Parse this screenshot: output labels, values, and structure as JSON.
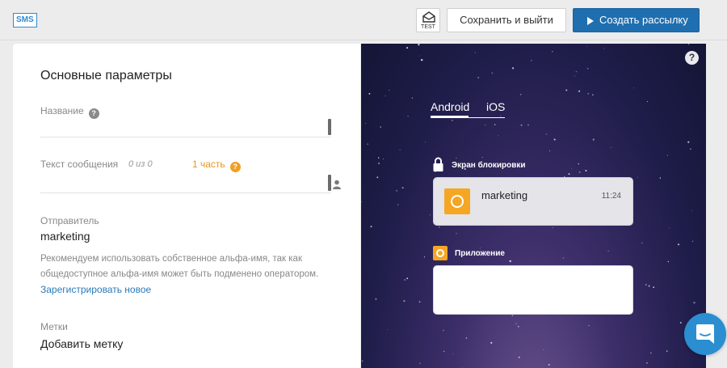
{
  "header": {
    "channel_badge": "SMS",
    "test_label": "TEST",
    "save_label": "Сохранить и выйти",
    "create_label": "Создать рассылку"
  },
  "form": {
    "section_title": "Основные параметры",
    "name": {
      "label": "Название",
      "value": ""
    },
    "message": {
      "label": "Текст сообщения",
      "counter": "0 из 0",
      "parts": "1 часть",
      "value": ""
    },
    "sender": {
      "label": "Отправитель",
      "value": "marketing",
      "hint": "Рекомендуем использовать собственное альфа-имя, так как общедоступное альфа-имя может быть подменено оператором.",
      "register_link": "Зарегистрировать новое"
    },
    "tags": {
      "label": "Метки",
      "add_label": "Добавить метку"
    }
  },
  "preview": {
    "help": "?",
    "tabs": [
      {
        "label": "Android",
        "active": true
      },
      {
        "label": "iOS",
        "active": false
      }
    ],
    "lock_screen_label": "Экран блокировки",
    "notification": {
      "title": "marketing",
      "time": "11:24"
    },
    "app_label": "Приложение",
    "accent_color": "#f5a623"
  },
  "colors": {
    "primary": "#1f6fb0",
    "link": "#2a7ab8",
    "warning": "#e8961e"
  }
}
